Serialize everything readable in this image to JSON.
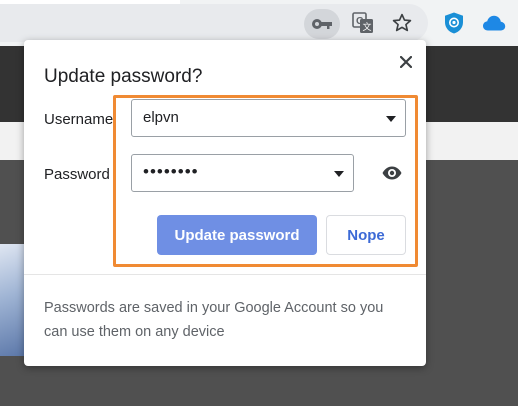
{
  "dialog": {
    "title": "Update password?",
    "username_label": "Username",
    "username_value": "elpvn",
    "password_label": "Password",
    "password_value": "••••••••",
    "update_button": "Update password",
    "nope_button": "Nope",
    "footer": "Passwords are saved in your Google Account so you can use them on any device"
  },
  "toolbar": {
    "icons": [
      "key-icon",
      "translate-icon",
      "star-icon",
      "shield-icon",
      "cloud-icon"
    ]
  },
  "colors": {
    "accent_button": "#6f8fe4",
    "highlight_outline": "#f08a33",
    "link_text": "#3c6ad6"
  }
}
